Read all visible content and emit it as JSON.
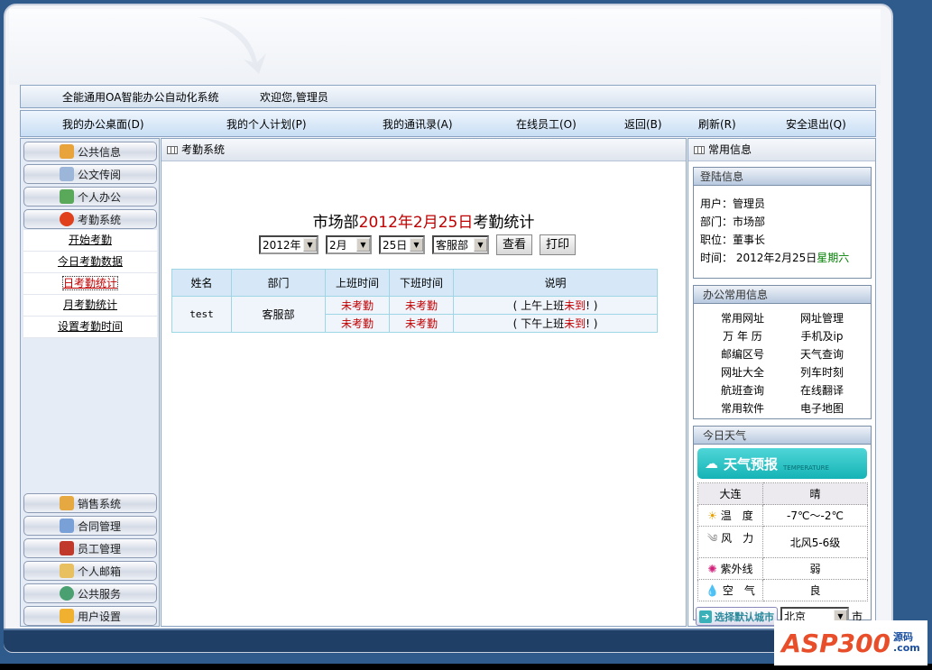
{
  "topbar": {
    "system_name": "全能通用OA智能办公自动化系统",
    "welcome": "欢迎您,管理员"
  },
  "nav": [
    {
      "label": "我的办公桌面(D)"
    },
    {
      "label": "我的个人计划(P)"
    },
    {
      "label": "我的通讯录(A)"
    },
    {
      "label": "在线员工(O)"
    },
    {
      "label": "返回(B)"
    },
    {
      "label": "刷新(R)"
    },
    {
      "label": "安全退出(Q)"
    }
  ],
  "sidebar": {
    "top_items": [
      {
        "label": "公共信息",
        "icon": "notepad-icon"
      },
      {
        "label": "公文传阅",
        "icon": "document-icon"
      },
      {
        "label": "个人办公",
        "icon": "person-icon"
      },
      {
        "label": "考勤系统",
        "icon": "clock-icon"
      }
    ],
    "sub_items": [
      {
        "label": "开始考勤"
      },
      {
        "label": "今日考勤数据"
      },
      {
        "label": "日考勤统计"
      },
      {
        "label": "月考勤统计"
      },
      {
        "label": "设置考勤时间"
      }
    ],
    "bottom_items": [
      {
        "label": "销售系统",
        "icon": "box-icon"
      },
      {
        "label": "合同管理",
        "icon": "contract-icon"
      },
      {
        "label": "员工管理",
        "icon": "users-icon"
      },
      {
        "label": "个人邮箱",
        "icon": "mail-icon"
      },
      {
        "label": "公共服务",
        "icon": "globe-icon"
      },
      {
        "label": "用户设置",
        "icon": "settings-icon"
      }
    ]
  },
  "main": {
    "panel_title": "考勤系统",
    "heading_dept": "市场部",
    "heading_date": "2012年2月25日",
    "heading_suffix": "考勤统计",
    "year": "2012年",
    "month": "2月",
    "day": "25日",
    "dept": "客服部",
    "view_btn": "查看",
    "print_btn": "打印",
    "columns": [
      "姓名",
      "部门",
      "上班时间",
      "下班时间",
      "说明"
    ],
    "row": {
      "name": "test",
      "dept": "客服部",
      "records": [
        {
          "in": "未考勤",
          "out": "未考勤",
          "note_pre": "( 上午上班",
          "note_red": "未到",
          "note_post": "! )"
        },
        {
          "in": "未考勤",
          "out": "未考勤",
          "note_pre": "( 下午上班",
          "note_red": "未到",
          "note_post": "! )"
        }
      ]
    }
  },
  "right": {
    "panel_title": "常用信息",
    "login": {
      "title": "登陆信息",
      "user": "用户：管理员",
      "dept": "部门：市场部",
      "position": "职位：董事长",
      "time_label": "时间： 2012年2月25日",
      "weekday": "星期六"
    },
    "office": {
      "title": "办公常用信息",
      "links": [
        "常用网址",
        "网址管理",
        "万 年 历",
        "手机及ip",
        "邮编区号",
        "天气查询",
        "网址大全",
        "列车时刻",
        "航班查询",
        "在线翻译",
        "常用软件",
        "电子地图"
      ]
    },
    "weather": {
      "title": "今日天气",
      "banner": "天气预报",
      "banner_sub": "TEMPERATURE",
      "city": "大连",
      "condition": "晴",
      "rows": [
        {
          "label": "温　度",
          "value": "-7℃～-2℃",
          "icon": "sun-icon"
        },
        {
          "label": "风　力",
          "value": "北风5-6级",
          "icon": "wind-icon"
        },
        {
          "label": "紫外线",
          "value": "弱",
          "icon": "uv-icon"
        },
        {
          "label": "空　气",
          "value": "良",
          "icon": "water-drop-icon"
        }
      ],
      "city_btn": "选择默认城市",
      "city_select": "北京",
      "city_suffix": "市"
    }
  },
  "watermark": {
    "text": "ASP300",
    "sub1": "源码",
    "sub2": ".com"
  },
  "colors": {
    "accent_red": "#c00000",
    "weekday_green": "#008000",
    "background": "#2f5a8c"
  }
}
